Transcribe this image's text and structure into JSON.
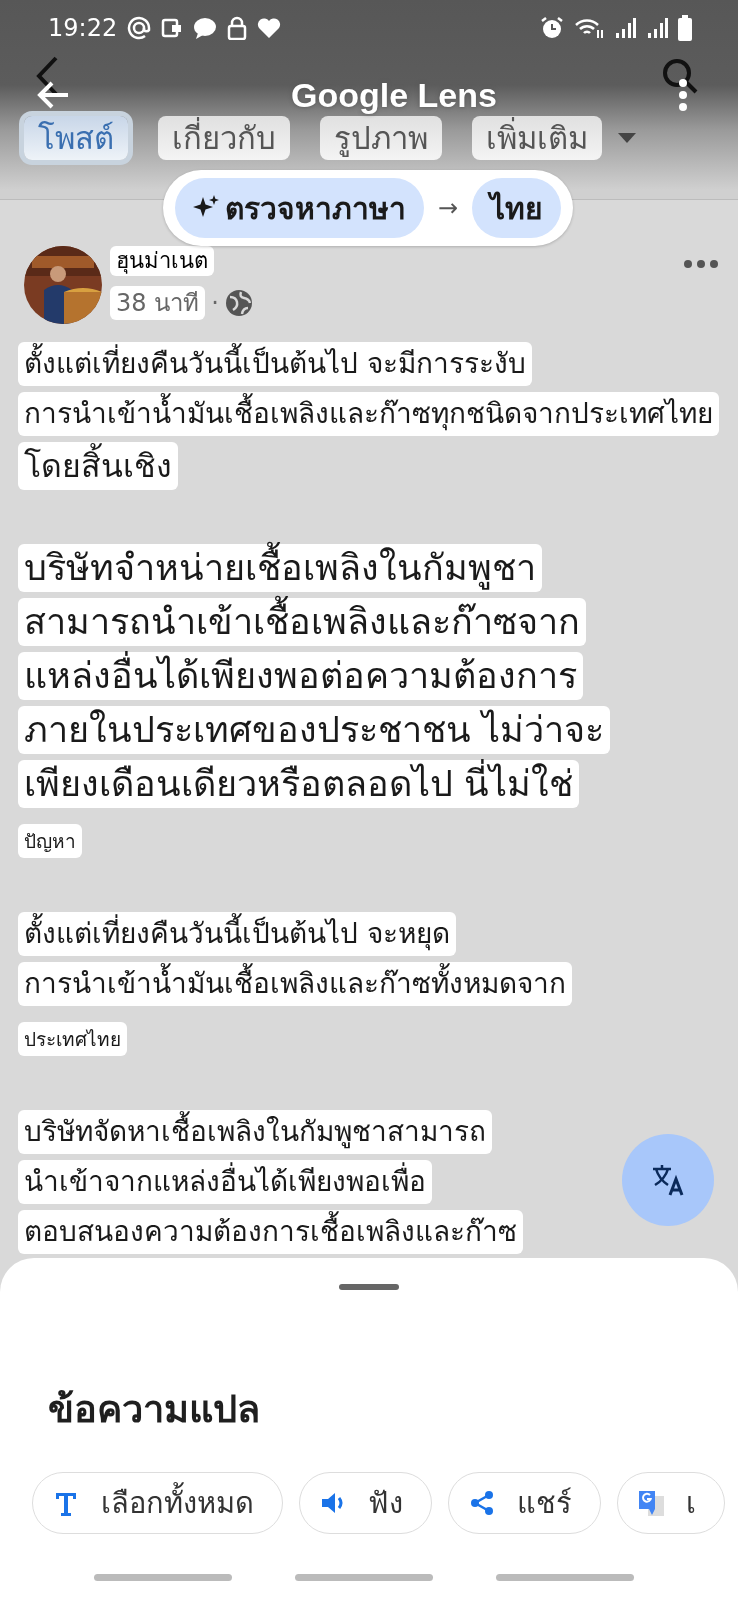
{
  "status_bar": {
    "time": "19:22"
  },
  "lens": {
    "title": "Google Lens"
  },
  "tabs": [
    {
      "label": "โพสต์",
      "selected": true
    },
    {
      "label": "เกี่ยวกับ",
      "selected": false
    },
    {
      "label": "รูปภาพ",
      "selected": false
    },
    {
      "label": "เพิ่มเติม",
      "selected": false
    }
  ],
  "language": {
    "source": "ตรวจหาภาษา",
    "arrow": "→",
    "target": "ไทย"
  },
  "post": {
    "author": "ฮุนม่าเนต",
    "time": "38 นาที",
    "separator": "·"
  },
  "paragraphs": [
    {
      "lines": [
        {
          "text": "ตั้งแต่เที่ยงคืนวันนี้เป็นต้นไป จะมีการระงับ",
          "kind": "medium"
        },
        {
          "text": "การนำเข้าน้ำมันเชื้อเพลิงและก๊าซทุกชนิดจากประเทศไทย",
          "kind": "medium"
        },
        {
          "text": "โดยสิ้นเชิง",
          "kind": "large"
        }
      ]
    },
    {
      "lines": [
        {
          "text": "บริษัทจำหน่ายเชื้อเพลิงในกัมพูชา",
          "kind": "xlarge"
        },
        {
          "text": "สามารถนำเข้าเชื้อเพลิงและก๊าซจาก",
          "kind": "xlarge"
        },
        {
          "text": "แหล่งอื่นได้เพียงพอต่อความต้องการ",
          "kind": "xlarge"
        },
        {
          "text": "ภายในประเทศของประชาชน ไม่ว่าจะ",
          "kind": "xlarge"
        },
        {
          "text": "เพียงเดือนเดียวหรือตลอดไป นี่ไม่ใช่",
          "kind": "xlarge"
        },
        {
          "text": "ปัญหา",
          "kind": "small"
        }
      ]
    },
    {
      "lines": [
        {
          "text": "ตั้งแต่เที่ยงคืนวันนี้เป็นต้นไป จะหยุด",
          "kind": "medium"
        },
        {
          "text": "การนำเข้าน้ำมันเชื้อเพลิงและก๊าซทั้งหมดจาก",
          "kind": "medium"
        },
        {
          "text": "ประเทศไทย",
          "kind": "small"
        }
      ]
    },
    {
      "lines": [
        {
          "text": "บริษัทจัดหาเชื้อเพลิงในกัมพูชาสามารถ",
          "kind": "medium"
        },
        {
          "text": "นำเข้าจากแหล่งอื่นได้เพียงพอเพื่อ",
          "kind": "medium"
        },
        {
          "text": "ตอบสนองความต้องการเชื้อเพลิงและก๊าซ",
          "kind": "medium"
        }
      ]
    }
  ],
  "sheet": {
    "title": "ข้อความแปล",
    "actions": [
      {
        "label": "เลือกทั้งหมด",
        "kind": "select"
      },
      {
        "label": "ฟัง",
        "kind": "listen"
      },
      {
        "label": "แชร์",
        "kind": "share"
      },
      {
        "label": "เ",
        "kind": "translate"
      }
    ]
  }
}
